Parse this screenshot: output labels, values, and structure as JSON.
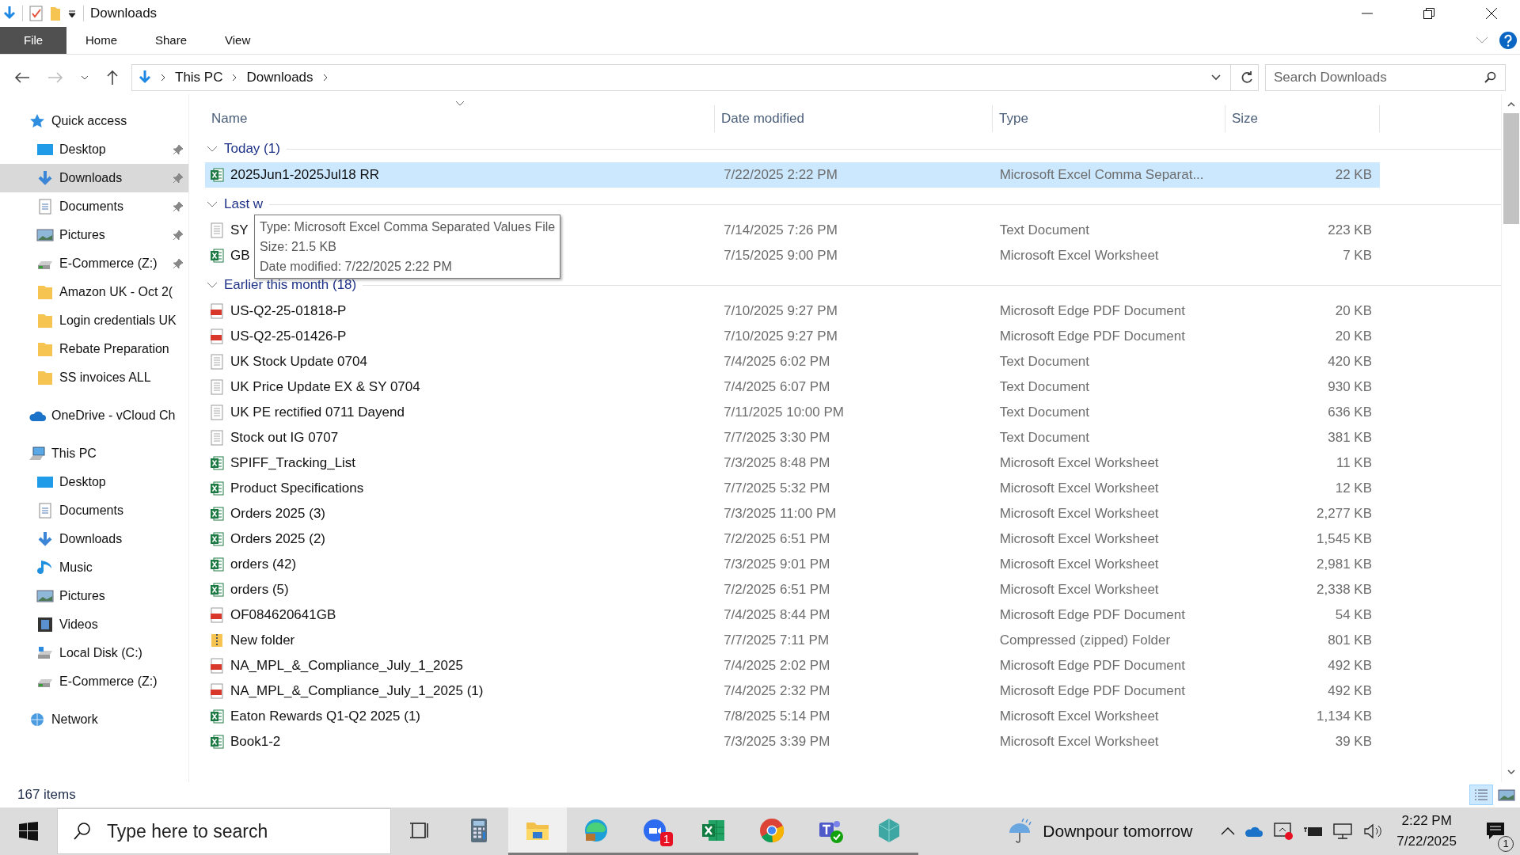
{
  "window": {
    "title": "Downloads"
  },
  "ribbon_tabs": [
    {
      "label": "File",
      "kind": "file"
    },
    {
      "label": "Home",
      "kind": "tab"
    },
    {
      "label": "Share",
      "kind": "tab"
    },
    {
      "label": "View",
      "kind": "tab"
    }
  ],
  "address_bar": {
    "crumbs": [
      "This PC",
      "Downloads"
    ]
  },
  "search": {
    "placeholder": "Search Downloads"
  },
  "sidebar": [
    {
      "label": "Quick access",
      "kind": "star",
      "selected": false,
      "children": [
        {
          "label": "Desktop",
          "kind": "desktop",
          "pinned": true,
          "selected": false
        },
        {
          "label": "Downloads",
          "kind": "download",
          "pinned": true,
          "selected": true
        },
        {
          "label": "Documents",
          "kind": "documents",
          "pinned": true,
          "selected": false
        },
        {
          "label": "Pictures",
          "kind": "pictures",
          "pinned": true,
          "selected": false
        },
        {
          "label": "E-Commerce (Z:)",
          "kind": "drive",
          "pinned": true,
          "selected": false
        },
        {
          "label": "Amazon UK - Oct 2(",
          "kind": "folder",
          "pinned": false,
          "selected": false
        },
        {
          "label": "Login credentials UK",
          "kind": "folder",
          "pinned": false,
          "selected": false
        },
        {
          "label": "Rebate Preparation",
          "kind": "folder",
          "pinned": false,
          "selected": false
        },
        {
          "label": "SS invoices ALL",
          "kind": "folder",
          "pinned": false,
          "selected": false
        }
      ]
    },
    {
      "label": "OneDrive - vCloud Ch",
      "kind": "cloud",
      "selected": false
    },
    {
      "label": "This PC",
      "kind": "pc",
      "selected": false,
      "children": [
        {
          "label": "Desktop",
          "kind": "desktop",
          "pinned": false,
          "selected": false
        },
        {
          "label": "Documents",
          "kind": "documents",
          "pinned": false,
          "selected": false
        },
        {
          "label": "Downloads",
          "kind": "download",
          "pinned": false,
          "selected": false
        },
        {
          "label": "Music",
          "kind": "music",
          "pinned": false,
          "selected": false
        },
        {
          "label": "Pictures",
          "kind": "pictures",
          "pinned": false,
          "selected": false
        },
        {
          "label": "Videos",
          "kind": "videos",
          "pinned": false,
          "selected": false
        },
        {
          "label": "Local Disk (C:)",
          "kind": "disk",
          "pinned": false,
          "selected": false
        },
        {
          "label": "E-Commerce (Z:)",
          "kind": "drive",
          "pinned": false,
          "selected": false
        }
      ]
    },
    {
      "label": "Network",
      "kind": "network",
      "selected": false
    }
  ],
  "columns": [
    "Name",
    "Date modified",
    "Type",
    "Size"
  ],
  "groups": [
    {
      "label": "Today (1)",
      "expanded": true,
      "rows": [
        {
          "name": "2025Jun1-2025Jul18 RR",
          "date": "7/22/2025 2:22 PM",
          "type": "Microsoft Excel Comma Separat...",
          "size": "22 KB",
          "kind": "csv",
          "selected": true
        }
      ]
    },
    {
      "label": "Last w",
      "expanded": true,
      "rows": [
        {
          "name": "SY",
          "date": "7/14/2025 7:26 PM",
          "type": "Text Document",
          "size": "223 KB",
          "kind": "text",
          "selected": false
        },
        {
          "name": "GB",
          "date": "7/15/2025 9:00 PM",
          "type": "Microsoft Excel Worksheet",
          "size": "7 KB",
          "kind": "excel",
          "selected": false
        }
      ]
    },
    {
      "label": "Earlier this month (18)",
      "expanded": true,
      "rows": [
        {
          "name": "US-Q2-25-01818-P",
          "date": "7/10/2025 9:27 PM",
          "type": "Microsoft Edge PDF Document",
          "size": "20 KB",
          "kind": "pdf",
          "selected": false
        },
        {
          "name": "US-Q2-25-01426-P",
          "date": "7/10/2025 9:27 PM",
          "type": "Microsoft Edge PDF Document",
          "size": "20 KB",
          "kind": "pdf",
          "selected": false
        },
        {
          "name": "UK Stock Update 0704",
          "date": "7/4/2025 6:02 PM",
          "type": "Text Document",
          "size": "420 KB",
          "kind": "text",
          "selected": false
        },
        {
          "name": "UK Price Update EX & SY 0704",
          "date": "7/4/2025 6:07 PM",
          "type": "Text Document",
          "size": "930 KB",
          "kind": "text",
          "selected": false
        },
        {
          "name": "UK PE rectified 0711 Dayend",
          "date": "7/11/2025 10:00 PM",
          "type": "Text Document",
          "size": "636 KB",
          "kind": "text",
          "selected": false
        },
        {
          "name": "Stock out IG 0707",
          "date": "7/7/2025 3:30 PM",
          "type": "Text Document",
          "size": "381 KB",
          "kind": "text",
          "selected": false
        },
        {
          "name": "SPIFF_Tracking_List",
          "date": "7/3/2025 8:48 PM",
          "type": "Microsoft Excel Worksheet",
          "size": "11 KB",
          "kind": "excel",
          "selected": false
        },
        {
          "name": "Product Specifications",
          "date": "7/7/2025 5:32 PM",
          "type": "Microsoft Excel Worksheet",
          "size": "12 KB",
          "kind": "excel",
          "selected": false
        },
        {
          "name": "Orders 2025 (3)",
          "date": "7/3/2025 11:00 PM",
          "type": "Microsoft Excel Worksheet",
          "size": "2,277 KB",
          "kind": "excel",
          "selected": false
        },
        {
          "name": "Orders 2025 (2)",
          "date": "7/2/2025 6:51 PM",
          "type": "Microsoft Excel Worksheet",
          "size": "1,545 KB",
          "kind": "excel",
          "selected": false
        },
        {
          "name": "orders (42)",
          "date": "7/3/2025 9:01 PM",
          "type": "Microsoft Excel Worksheet",
          "size": "2,981 KB",
          "kind": "excel",
          "selected": false
        },
        {
          "name": "orders (5)",
          "date": "7/2/2025 6:51 PM",
          "type": "Microsoft Excel Worksheet",
          "size": "2,338 KB",
          "kind": "excel",
          "selected": false
        },
        {
          "name": "OF084620641GB",
          "date": "7/4/2025 8:44 PM",
          "type": "Microsoft Edge PDF Document",
          "size": "54 KB",
          "kind": "pdf",
          "selected": false
        },
        {
          "name": "New folder",
          "date": "7/7/2025 7:11 PM",
          "type": "Compressed (zipped) Folder",
          "size": "801 KB",
          "kind": "zip",
          "selected": false
        },
        {
          "name": "NA_MPL_&_Compliance_July_1_2025",
          "date": "7/4/2025 2:02 PM",
          "type": "Microsoft Edge PDF Document",
          "size": "492 KB",
          "kind": "pdf",
          "selected": false
        },
        {
          "name": "NA_MPL_&_Compliance_July_1_2025 (1)",
          "date": "7/4/2025 2:32 PM",
          "type": "Microsoft Edge PDF Document",
          "size": "492 KB",
          "kind": "pdf",
          "selected": false
        },
        {
          "name": "Eaton Rewards Q1-Q2 2025 (1)",
          "date": "7/8/2025 5:14 PM",
          "type": "Microsoft Excel Worksheet",
          "size": "1,134 KB",
          "kind": "excel",
          "selected": false
        },
        {
          "name": "Book1-2",
          "date": "7/3/2025 3:39 PM",
          "type": "Microsoft Excel Worksheet",
          "size": "39 KB",
          "kind": "excel",
          "selected": false
        }
      ]
    }
  ],
  "tooltip": [
    "Type: Microsoft Excel Comma Separated Values File",
    "Size: 21.5 KB",
    "Date modified: 7/22/2025 2:22 PM"
  ],
  "status_bar": {
    "count": "167 items"
  },
  "taskbar": {
    "search_placeholder": "Type here to search",
    "apps": [
      {
        "kind": "taskview",
        "running": false,
        "active": false
      },
      {
        "kind": "calculator",
        "running": false,
        "active": false
      },
      {
        "kind": "explorer",
        "running": true,
        "active": true
      },
      {
        "kind": "edge",
        "running": true,
        "active": false
      },
      {
        "kind": "zoom",
        "running": true,
        "active": false,
        "badge": "1"
      },
      {
        "kind": "excel",
        "running": true,
        "active": false
      },
      {
        "kind": "chrome",
        "running": true,
        "active": false
      },
      {
        "kind": "teams",
        "running": true,
        "active": false
      },
      {
        "kind": "gem",
        "running": true,
        "active": false
      }
    ],
    "weather": "Downpour tomorrow",
    "time": "2:22 PM",
    "date": "7/22/2025",
    "notifications": "1"
  }
}
